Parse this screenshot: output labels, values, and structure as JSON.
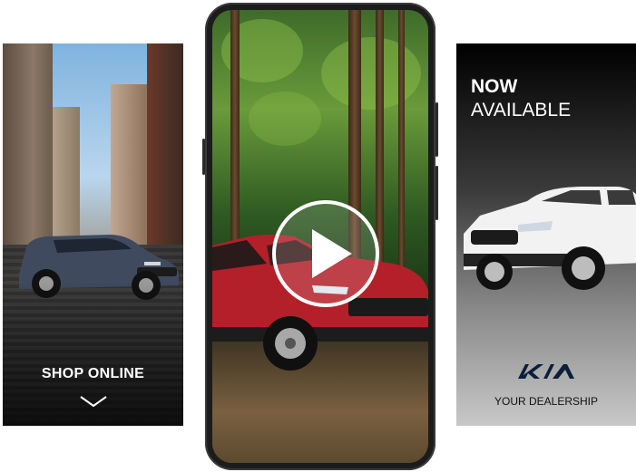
{
  "left_panel": {
    "cta_label": "SHOP ONLINE",
    "icon": "chevron-down-icon"
  },
  "phone": {
    "play_icon": "play-icon"
  },
  "right_panel": {
    "headline_bold": "NOW",
    "headline_light": "AVAILABLE",
    "logo_text": "KIA",
    "dealer_label": "YOUR DEALERSHIP"
  },
  "colors": {
    "cta_text": "#ffffff",
    "dealer_text": "#111111",
    "car_red": "#b3202a",
    "car_blue": "#3f4a5f",
    "car_white": "#f2f2f2"
  }
}
